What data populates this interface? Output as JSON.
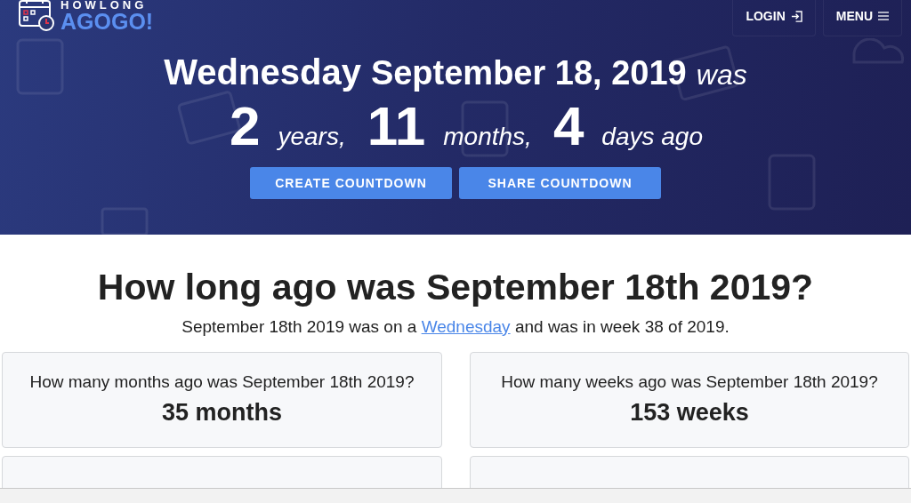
{
  "logo": {
    "top": "HOWLONG",
    "bottom": "AGOGO!"
  },
  "nav": [
    {
      "label": "LOGIN",
      "kind": "login"
    },
    {
      "label": "MENU",
      "kind": "menu"
    }
  ],
  "hero": {
    "weekday": "Wednesday",
    "date": "September 18, 2019",
    "suffix": "was",
    "counts": [
      {
        "value": "2",
        "unit": "years,"
      },
      {
        "value": "11",
        "unit": "months,"
      },
      {
        "value": "4",
        "unit": "days ago"
      }
    ],
    "buttons": [
      "CREATE COUNTDOWN",
      "SHARE COUNTDOWN"
    ]
  },
  "heading": "How long ago was September 18th 2019?",
  "summary": {
    "before": "September 18th 2019 was on a",
    "link": "Wednesday",
    "after": "and was in week 38 of 2019."
  },
  "cards": [
    {
      "question": "How many months ago was September 18th 2019?",
      "answer": "35 months"
    },
    {
      "question": "How many weeks ago was September 18th 2019?",
      "answer": "153 weeks"
    }
  ]
}
